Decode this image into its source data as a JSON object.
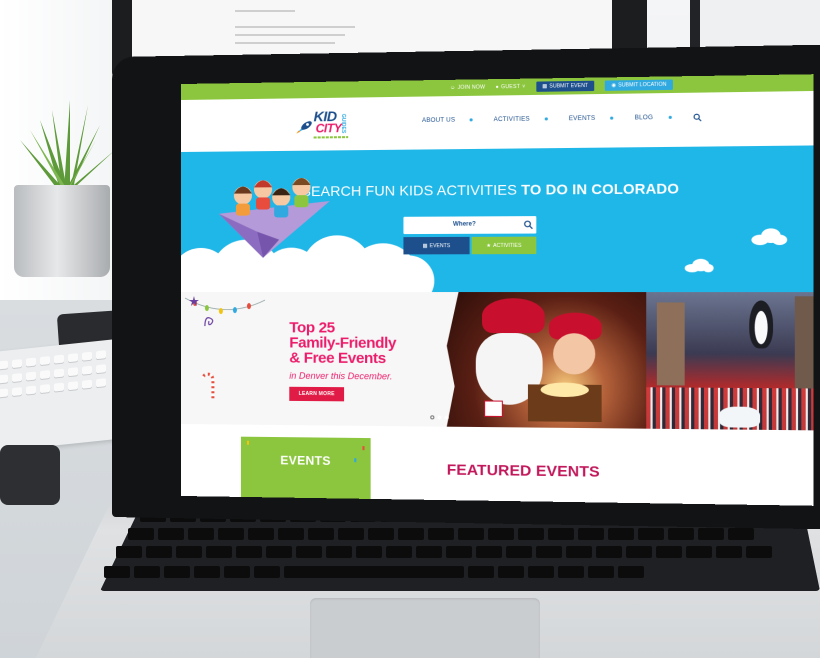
{
  "topbar": {
    "join_now": "JOIN NOW",
    "guest": "GUEST",
    "submit_event": "SUBMIT EVENT",
    "submit_location": "SUBMIT LOCATION"
  },
  "logo": {
    "line1": "KID",
    "line2": "CITY",
    "side": "GUIDES"
  },
  "nav": {
    "items": [
      {
        "label": "ABOUT US"
      },
      {
        "label": "ACTIVITIES"
      },
      {
        "label": "EVENTS"
      },
      {
        "label": "BLOG"
      }
    ],
    "search_icon": "search-icon"
  },
  "hero": {
    "title_light": "SEARCH FUN KIDS ACTIVITIES ",
    "title_bold": "TO DO IN COLORADO",
    "search_placeholder": "Where?",
    "btn_events": "EVENTS",
    "btn_activities": "ACTIVITIES"
  },
  "banner": {
    "title_line1": "Top 25",
    "title_line2": "Family-Friendly",
    "title_line3": "& Free Events",
    "subtitle": "in Denver this December.",
    "cta": "LEARN MORE"
  },
  "sections": {
    "events_tab": "EVENTS",
    "featured": "FEATURED EVENTS"
  },
  "colors": {
    "green": "#8cc63f",
    "navy": "#1c4f8c",
    "sky": "#1fb6e8",
    "pink": "#ec1c6b",
    "red": "#e01b45"
  }
}
